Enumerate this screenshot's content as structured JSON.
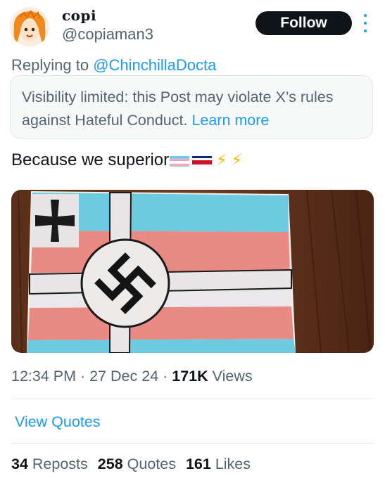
{
  "user": {
    "display_name": "copi",
    "handle": "@copiaman3",
    "follow_label": "Follow"
  },
  "reply": {
    "prefix": "Replying to ",
    "to_handle": "@ChinchillaDocta"
  },
  "notice": {
    "text": "Visibility limited: this Post may violate X’s rules against Hateful Conduct.",
    "link": "Learn more"
  },
  "post": {
    "text": "Because we superior",
    "emojis": [
      "trans-flag-emoji",
      "costa-rica-flag-emoji",
      "lightning-emoji",
      "lightning-emoji"
    ]
  },
  "meta": {
    "time": "12:34 PM",
    "sep1": " · ",
    "date": "27 Dec 24",
    "sep2": " · ",
    "views_count": "171K",
    "views_label": " Views"
  },
  "actions": {
    "view_quotes": "View Quotes"
  },
  "stats": {
    "reposts_count": "34",
    "reposts_label": "Reposts",
    "quotes_count": "258",
    "quotes_label": "Quotes",
    "likes_count": "161",
    "likes_label": "Likes"
  },
  "colors": {
    "accent": "#1d9bf0",
    "text": "#0f1419",
    "muted": "#536471"
  }
}
